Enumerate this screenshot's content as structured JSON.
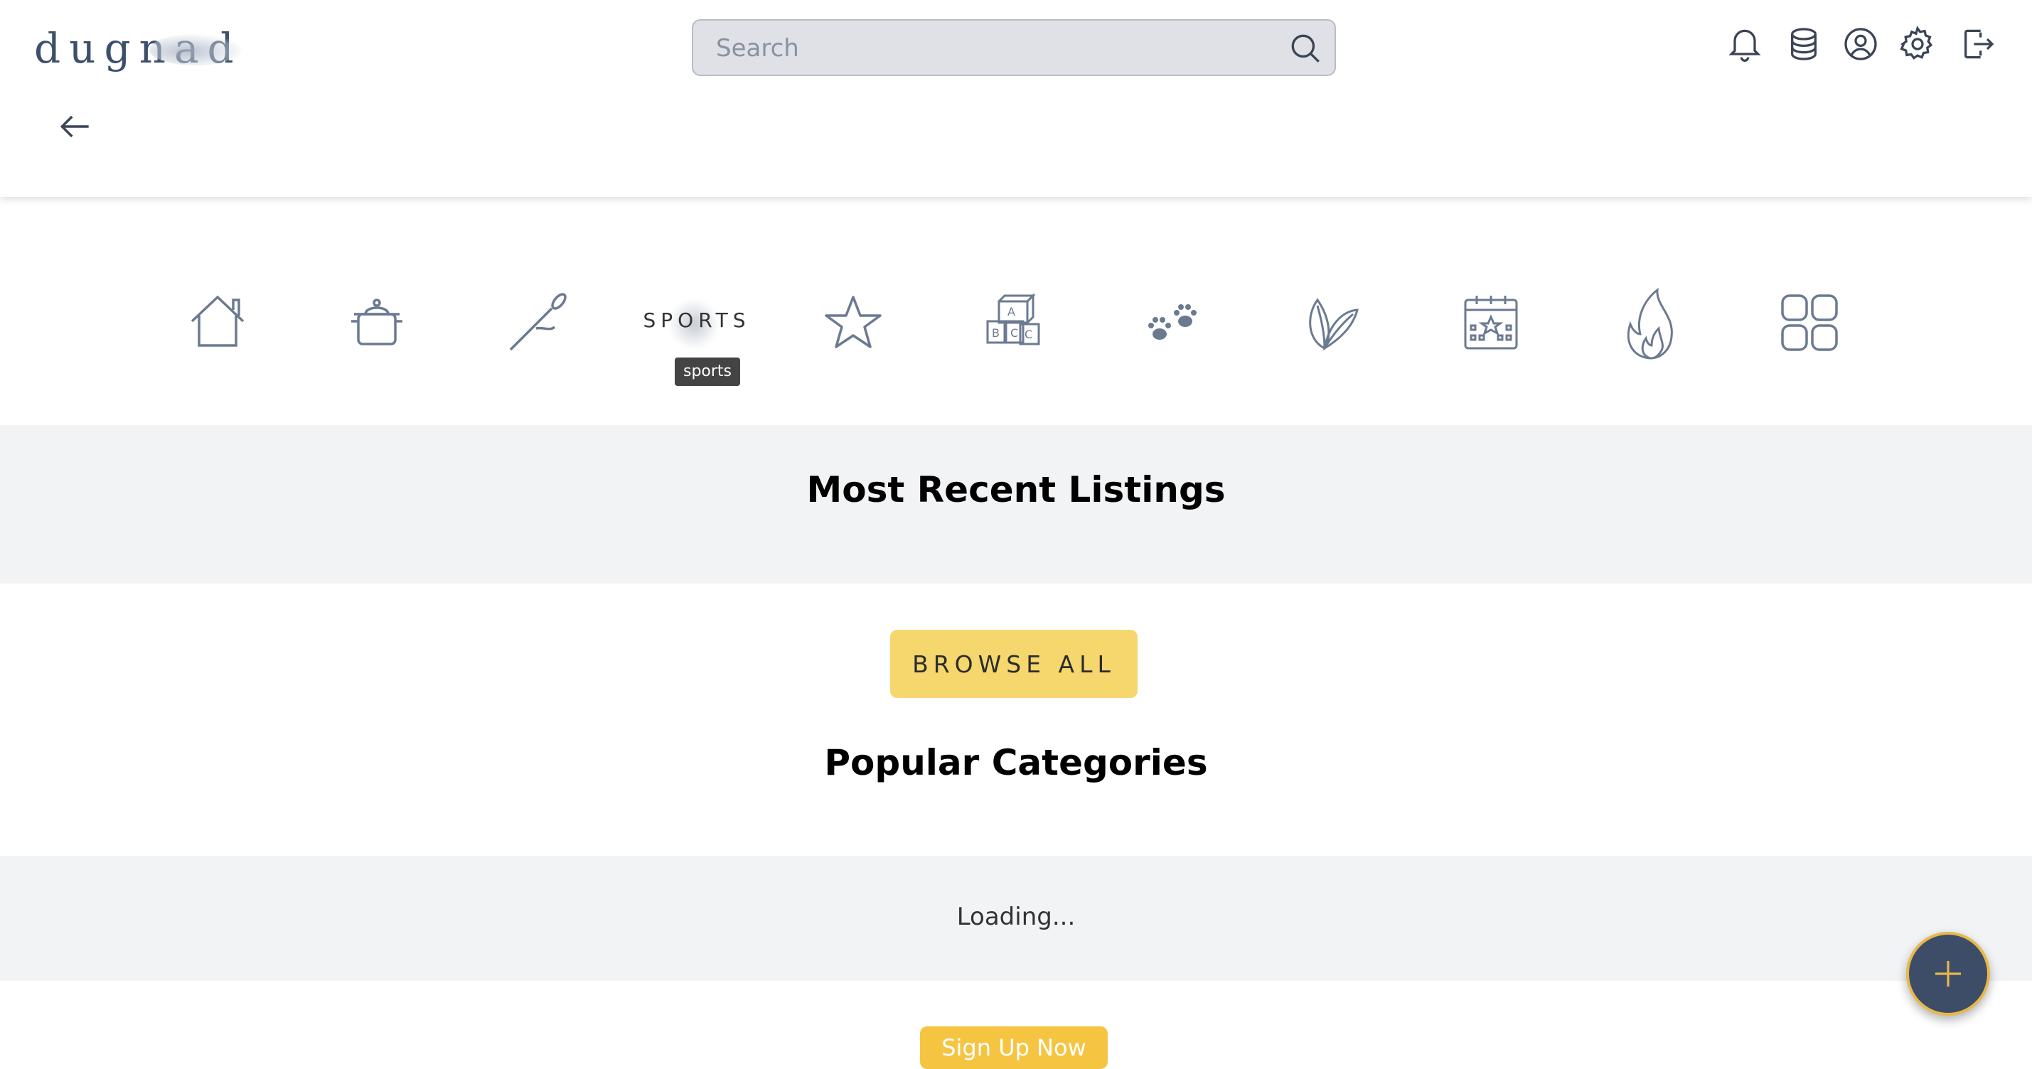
{
  "header": {
    "logo_text": "dugnad",
    "search": {
      "placeholder": "Search"
    },
    "icons": [
      "bell-icon",
      "database-icon",
      "user-icon",
      "gear-icon",
      "logout-icon"
    ]
  },
  "nav": {
    "back_icon": "arrow-left-icon"
  },
  "categories": {
    "icons": [
      "home-icon",
      "pot-icon",
      "needle-icon",
      "sports-icon",
      "star-icon",
      "blocks-icon",
      "paw-icon",
      "leaf-icon",
      "calendar-icon",
      "flame-icon",
      "grid-icon"
    ],
    "hover_label": "SPORTS",
    "tooltip": "sports"
  },
  "sections": {
    "recent_title": "Most Recent Listings",
    "browse_label": "BROWSE ALL",
    "popular_title": "Popular Categories",
    "loading_text": "Loading...",
    "signup_label": "Sign Up Now"
  },
  "fab": {
    "icon": "plus-icon"
  },
  "colors": {
    "icon_stroke": "#6b7a90",
    "accent_yellow": "#f5d76e",
    "fab_bg": "#3d4d68",
    "band_bg": "#f2f3f5"
  }
}
